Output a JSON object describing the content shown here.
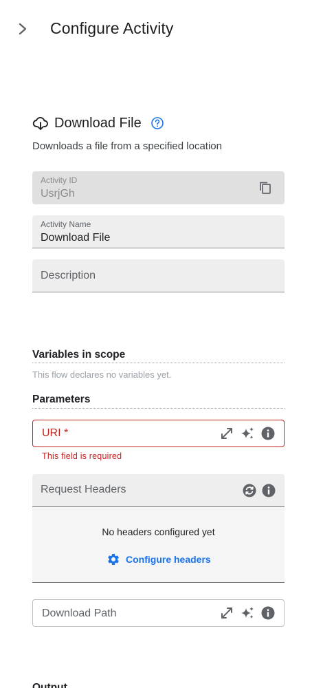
{
  "header": {
    "title": "Configure Activity",
    "collapse_icon": "chevron-right-icon"
  },
  "activity": {
    "icon": "cloud-download-icon",
    "title": "Download File",
    "help_icon": "help-circle-icon",
    "description": "Downloads a file from a specified location"
  },
  "fields": {
    "activity_id": {
      "label": "Activity ID",
      "value": "UsrjGh",
      "icon": "copy-icon"
    },
    "activity_name": {
      "label": "Activity Name",
      "value": "Download File"
    },
    "description": {
      "placeholder": "Description"
    }
  },
  "variables": {
    "title": "Variables in scope",
    "empty_text": "This flow declares no variables yet."
  },
  "parameters": {
    "title": "Parameters",
    "uri": {
      "placeholder": "URI *",
      "error": "This field is required",
      "icons": [
        "expand-icon",
        "sparkle-icon",
        "info-icon"
      ]
    },
    "request_headers": {
      "label": "Request Headers",
      "icons": [
        "sync-icon",
        "info-icon"
      ],
      "empty_text": "No headers configured yet",
      "configure_label": "Configure headers",
      "configure_icon": "gear-icon"
    },
    "download_path": {
      "placeholder": "Download Path",
      "icons": [
        "expand-icon",
        "sparkle-icon",
        "info-icon"
      ]
    }
  },
  "output": {
    "title": "Output"
  },
  "colors": {
    "error": "#c5221f",
    "accent": "#1a73e8",
    "field_bg": "#eeeeee"
  }
}
